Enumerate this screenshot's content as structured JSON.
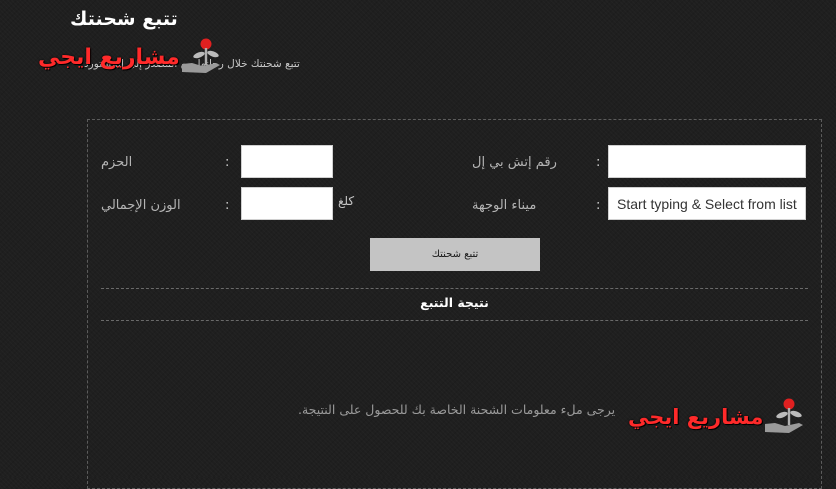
{
  "header": {
    "title": "تتبع شحنتك",
    "subtitle": "تتبع شحنتك خلال رحلتها من المصدر إلى المستورد"
  },
  "watermark": {
    "text": "مشاريع ايجي",
    "color": "#ff2a2a",
    "icon": "money-plant-in-hand-icon"
  },
  "form": {
    "awb_label": "رقم إتش بي إل",
    "pieces_label": "الحزم",
    "destination_label": "ميناء الوجهة",
    "weight_label": "الوزن الإجمالي",
    "colon": ":",
    "awb_value": "",
    "pieces_value": "",
    "weight_value": "",
    "destination_placeholder": "Start typing & Select from list",
    "weight_unit": "كلغ",
    "submit_label": "تتبع شحنتك"
  },
  "result": {
    "heading": "نتيجة التتبع",
    "message": "يرجى ملء معلومات الشحنة الخاصة بك للحصول على النتيجة."
  },
  "colors": {
    "background": "#1f1f1f",
    "button": "#c4c4c4",
    "title": "#ffffff"
  }
}
